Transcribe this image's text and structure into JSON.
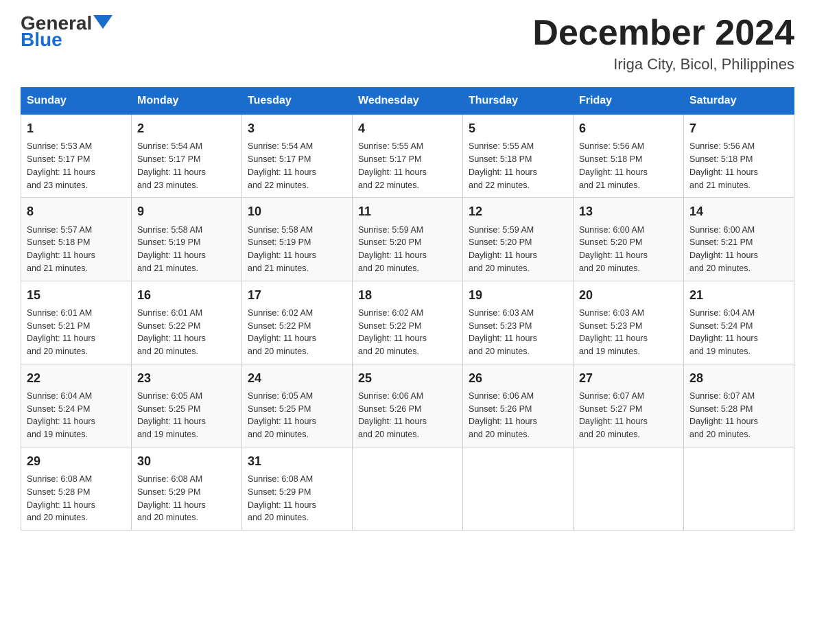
{
  "header": {
    "logo_general": "General",
    "logo_blue": "Blue",
    "month_title": "December 2024",
    "subtitle": "Iriga City, Bicol, Philippines"
  },
  "weekdays": [
    "Sunday",
    "Monday",
    "Tuesday",
    "Wednesday",
    "Thursday",
    "Friday",
    "Saturday"
  ],
  "weeks": [
    [
      {
        "day": "1",
        "sunrise": "5:53 AM",
        "sunset": "5:17 PM",
        "daylight": "11 hours and 23 minutes."
      },
      {
        "day": "2",
        "sunrise": "5:54 AM",
        "sunset": "5:17 PM",
        "daylight": "11 hours and 23 minutes."
      },
      {
        "day": "3",
        "sunrise": "5:54 AM",
        "sunset": "5:17 PM",
        "daylight": "11 hours and 22 minutes."
      },
      {
        "day": "4",
        "sunrise": "5:55 AM",
        "sunset": "5:17 PM",
        "daylight": "11 hours and 22 minutes."
      },
      {
        "day": "5",
        "sunrise": "5:55 AM",
        "sunset": "5:18 PM",
        "daylight": "11 hours and 22 minutes."
      },
      {
        "day": "6",
        "sunrise": "5:56 AM",
        "sunset": "5:18 PM",
        "daylight": "11 hours and 21 minutes."
      },
      {
        "day": "7",
        "sunrise": "5:56 AM",
        "sunset": "5:18 PM",
        "daylight": "11 hours and 21 minutes."
      }
    ],
    [
      {
        "day": "8",
        "sunrise": "5:57 AM",
        "sunset": "5:18 PM",
        "daylight": "11 hours and 21 minutes."
      },
      {
        "day": "9",
        "sunrise": "5:58 AM",
        "sunset": "5:19 PM",
        "daylight": "11 hours and 21 minutes."
      },
      {
        "day": "10",
        "sunrise": "5:58 AM",
        "sunset": "5:19 PM",
        "daylight": "11 hours and 21 minutes."
      },
      {
        "day": "11",
        "sunrise": "5:59 AM",
        "sunset": "5:20 PM",
        "daylight": "11 hours and 20 minutes."
      },
      {
        "day": "12",
        "sunrise": "5:59 AM",
        "sunset": "5:20 PM",
        "daylight": "11 hours and 20 minutes."
      },
      {
        "day": "13",
        "sunrise": "6:00 AM",
        "sunset": "5:20 PM",
        "daylight": "11 hours and 20 minutes."
      },
      {
        "day": "14",
        "sunrise": "6:00 AM",
        "sunset": "5:21 PM",
        "daylight": "11 hours and 20 minutes."
      }
    ],
    [
      {
        "day": "15",
        "sunrise": "6:01 AM",
        "sunset": "5:21 PM",
        "daylight": "11 hours and 20 minutes."
      },
      {
        "day": "16",
        "sunrise": "6:01 AM",
        "sunset": "5:22 PM",
        "daylight": "11 hours and 20 minutes."
      },
      {
        "day": "17",
        "sunrise": "6:02 AM",
        "sunset": "5:22 PM",
        "daylight": "11 hours and 20 minutes."
      },
      {
        "day": "18",
        "sunrise": "6:02 AM",
        "sunset": "5:22 PM",
        "daylight": "11 hours and 20 minutes."
      },
      {
        "day": "19",
        "sunrise": "6:03 AM",
        "sunset": "5:23 PM",
        "daylight": "11 hours and 20 minutes."
      },
      {
        "day": "20",
        "sunrise": "6:03 AM",
        "sunset": "5:23 PM",
        "daylight": "11 hours and 19 minutes."
      },
      {
        "day": "21",
        "sunrise": "6:04 AM",
        "sunset": "5:24 PM",
        "daylight": "11 hours and 19 minutes."
      }
    ],
    [
      {
        "day": "22",
        "sunrise": "6:04 AM",
        "sunset": "5:24 PM",
        "daylight": "11 hours and 19 minutes."
      },
      {
        "day": "23",
        "sunrise": "6:05 AM",
        "sunset": "5:25 PM",
        "daylight": "11 hours and 19 minutes."
      },
      {
        "day": "24",
        "sunrise": "6:05 AM",
        "sunset": "5:25 PM",
        "daylight": "11 hours and 20 minutes."
      },
      {
        "day": "25",
        "sunrise": "6:06 AM",
        "sunset": "5:26 PM",
        "daylight": "11 hours and 20 minutes."
      },
      {
        "day": "26",
        "sunrise": "6:06 AM",
        "sunset": "5:26 PM",
        "daylight": "11 hours and 20 minutes."
      },
      {
        "day": "27",
        "sunrise": "6:07 AM",
        "sunset": "5:27 PM",
        "daylight": "11 hours and 20 minutes."
      },
      {
        "day": "28",
        "sunrise": "6:07 AM",
        "sunset": "5:28 PM",
        "daylight": "11 hours and 20 minutes."
      }
    ],
    [
      {
        "day": "29",
        "sunrise": "6:08 AM",
        "sunset": "5:28 PM",
        "daylight": "11 hours and 20 minutes."
      },
      {
        "day": "30",
        "sunrise": "6:08 AM",
        "sunset": "5:29 PM",
        "daylight": "11 hours and 20 minutes."
      },
      {
        "day": "31",
        "sunrise": "6:08 AM",
        "sunset": "5:29 PM",
        "daylight": "11 hours and 20 minutes."
      },
      null,
      null,
      null,
      null
    ]
  ],
  "labels": {
    "sunrise": "Sunrise:",
    "sunset": "Sunset:",
    "daylight": "Daylight:"
  }
}
